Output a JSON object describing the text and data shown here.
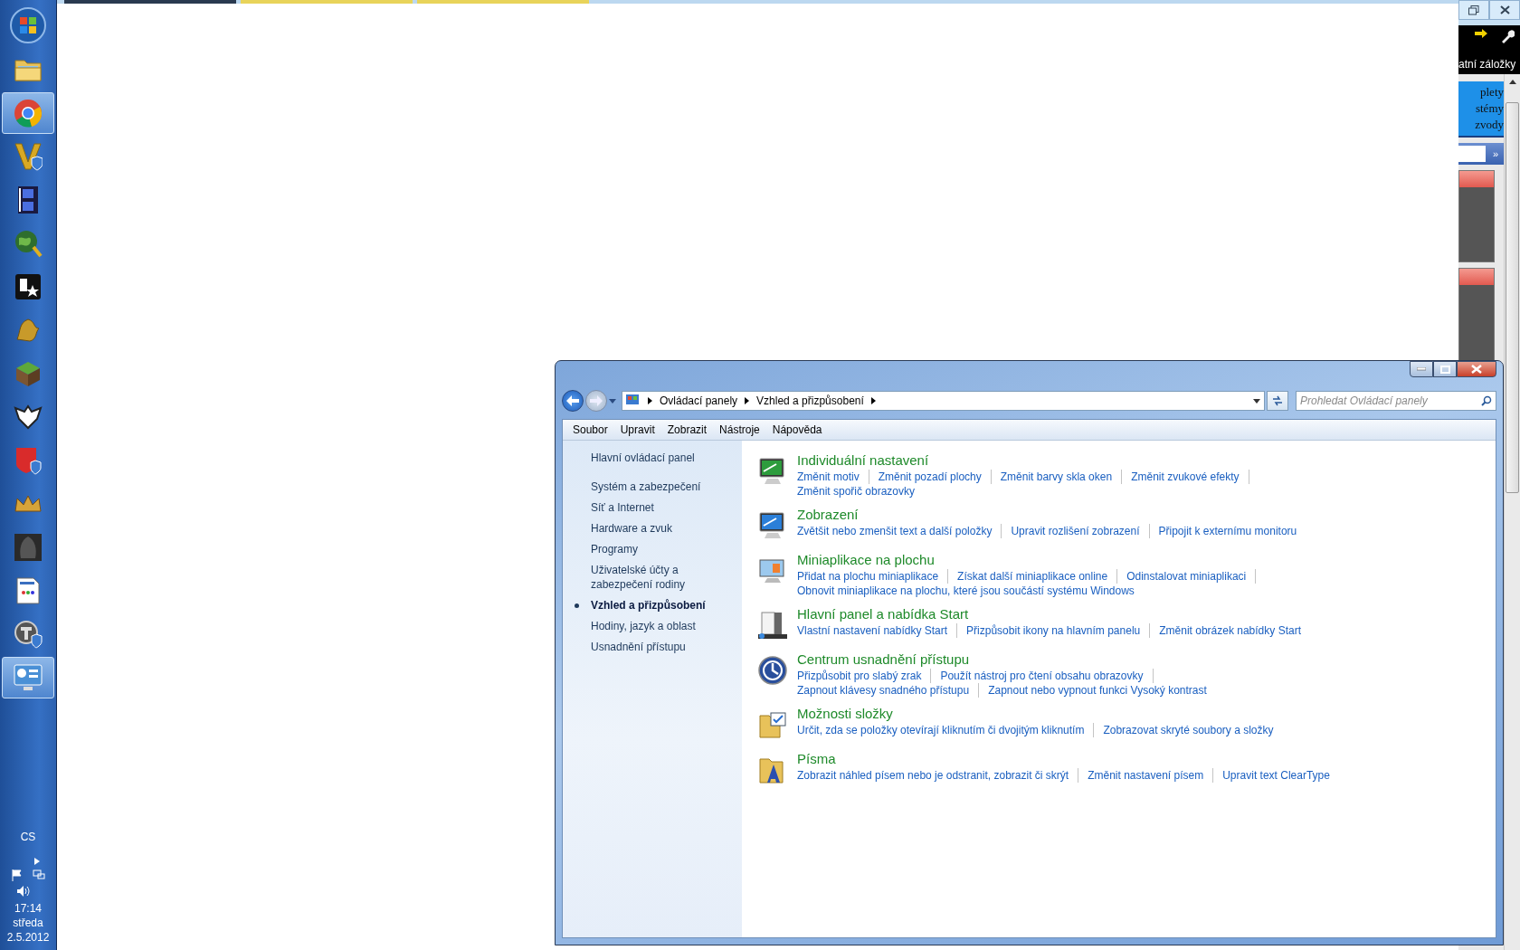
{
  "taskbar": {
    "apps": [
      {
        "kind": "folder",
        "selected": false
      },
      {
        "kind": "browser",
        "selected": true
      },
      {
        "kind": "chevron",
        "selected": false
      },
      {
        "kind": "film",
        "selected": false
      },
      {
        "kind": "globe",
        "selected": false
      },
      {
        "kind": "star",
        "selected": false
      },
      {
        "kind": "griffin",
        "selected": false
      },
      {
        "kind": "cube",
        "selected": false
      },
      {
        "kind": "emblem",
        "selected": false
      },
      {
        "kind": "redshield",
        "selected": false
      },
      {
        "kind": "crown",
        "selected": false
      },
      {
        "kind": "hood",
        "selected": false
      },
      {
        "kind": "document",
        "selected": false
      },
      {
        "kind": "tank",
        "selected": false
      },
      {
        "kind": "controlpanel",
        "selected": true
      }
    ],
    "language": "CS",
    "time": "17:14",
    "day": "středa",
    "date": "2.5.2012"
  },
  "browser": {
    "tabs": [
      {
        "selected": true
      },
      {
        "selected": false
      },
      {
        "selected": false
      }
    ],
    "toolbar_text": "atní záložky",
    "banner_lines": [
      "plety",
      "stémy",
      "zvody"
    ],
    "go_button": "»"
  },
  "window": {
    "address": [
      "Ovládací panely",
      "Vzhled a přizpůsobení"
    ],
    "search": {
      "placeholder": "Prohledat Ovládací panely"
    },
    "menu": [
      "Soubor",
      "Upravit",
      "Zobrazit",
      "Nástroje",
      "Nápověda"
    ],
    "home_link": "Hlavní ovládací panel",
    "nav": [
      {
        "label": "Systém a zabezpečení",
        "selected": false
      },
      {
        "label": "Síť a Internet",
        "selected": false
      },
      {
        "label": "Hardware a zvuk",
        "selected": false
      },
      {
        "label": "Programy",
        "selected": false
      },
      {
        "label": "Uživatelské účty a zabezpečení rodiny",
        "selected": false
      },
      {
        "label": "Vzhled a přizpůsobení",
        "selected": true
      },
      {
        "label": "Hodiny, jazyk a oblast",
        "selected": false
      },
      {
        "label": "Usnadnění přístupu",
        "selected": false
      }
    ],
    "categories": [
      {
        "kind": "personalization",
        "title": "Individuální nastavení",
        "rows": [
          [
            "Změnit motiv",
            "Změnit pozadí plochy",
            "Změnit barvy skla oken",
            "Změnit zvukové efekty"
          ],
          [
            "Změnit spořič obrazovky"
          ]
        ]
      },
      {
        "kind": "display",
        "title": "Zobrazení",
        "rows": [
          [
            "Zvětšit nebo zmenšit text a další položky",
            "Upravit rozlišení zobrazení",
            "Připojit k externímu monitoru"
          ]
        ]
      },
      {
        "kind": "gadgets",
        "title": "Miniaplikace na plochu",
        "rows": [
          [
            "Přidat na plochu miniaplikace",
            "Získat další miniaplikace online",
            "Odinstalovat miniaplikaci"
          ],
          [
            "Obnovit miniaplikace na plochu, které jsou součástí systému Windows"
          ]
        ]
      },
      {
        "kind": "taskbar",
        "title": "Hlavní panel a nabídka Start",
        "rows": [
          [
            "Vlastní nastavení nabídky Start",
            "Přizpůsobit ikony na hlavním panelu",
            "Změnit obrázek nabídky Start"
          ]
        ]
      },
      {
        "kind": "ease",
        "title": "Centrum usnadnění přístupu",
        "rows": [
          [
            "Přizpůsobit pro slabý zrak",
            "Použít nástroj pro čtení obsahu obrazovky"
          ],
          [
            "Zapnout klávesy snadného přístupu",
            "Zapnout nebo vypnout funkci Vysoký kontrast"
          ]
        ]
      },
      {
        "kind": "folder",
        "title": "Možnosti složky",
        "rows": [
          [
            "Určit, zda se položky otevírají kliknutím či dvojitým kliknutím",
            "Zobrazovat skryté soubory a složky"
          ]
        ]
      },
      {
        "kind": "fonts",
        "title": "Písma",
        "rows": [
          [
            "Zobrazit náhled písem nebo je odstranit, zobrazit či skrýt",
            "Změnit nastavení písem",
            "Upravit text ClearType"
          ]
        ]
      }
    ]
  }
}
